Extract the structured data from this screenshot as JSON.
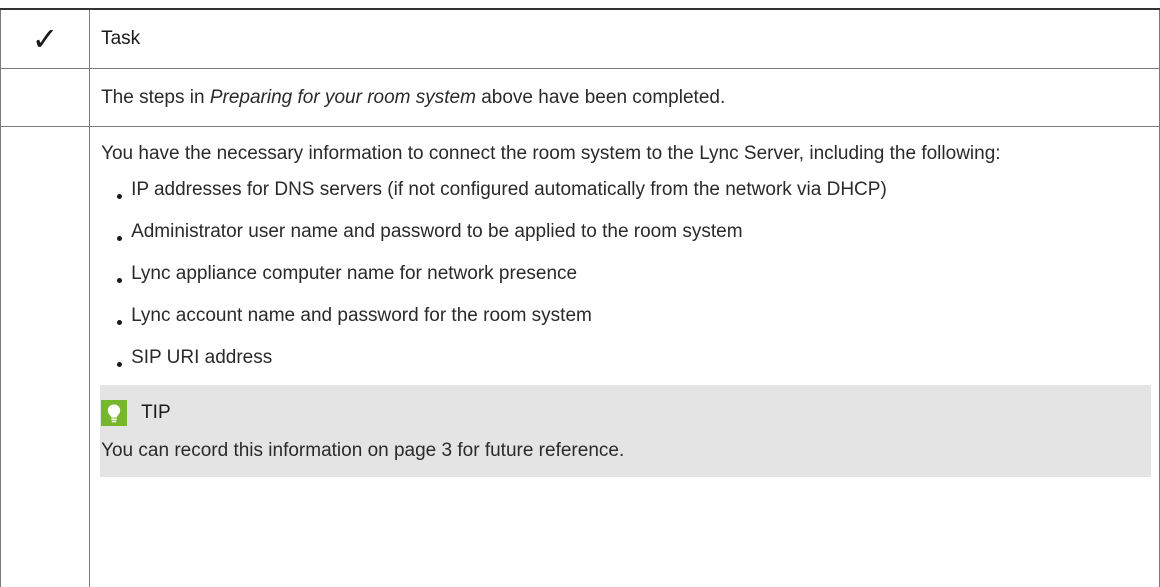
{
  "table": {
    "header": {
      "check_symbol": "✓",
      "task_label": "Task"
    },
    "rows": [
      {
        "text_before": "The steps in ",
        "link_text": "Preparing for your room system",
        "text_after": "  above have been completed."
      },
      {
        "intro": "You have the necessary information to connect the room system to the Lync Server, including the following:",
        "bullets": [
          "IP addresses for DNS servers (if not configured automatically from the network via DHCP)",
          "Administrator user name and password to be applied to the room system",
          "Lync appliance computer name for network presence",
          "Lync account name and password for the room system",
          "SIP URI address"
        ],
        "tip": {
          "icon": "lightbulb-icon",
          "title": "TIP",
          "text": "You can record this information on page 3 for future reference."
        }
      }
    ]
  },
  "colors": {
    "tip_background": "#e4e4e4",
    "tip_icon": "#76b82a"
  }
}
